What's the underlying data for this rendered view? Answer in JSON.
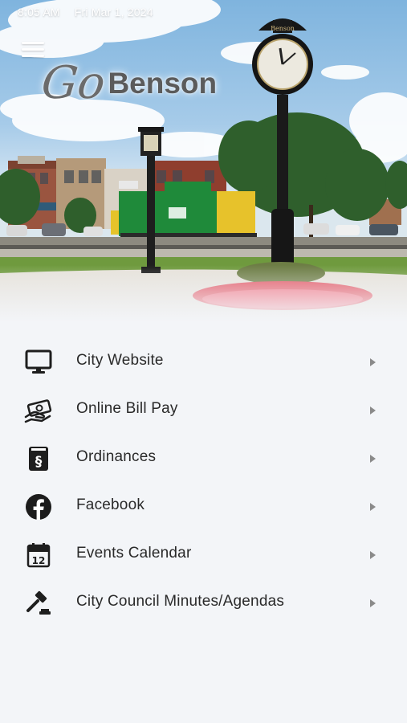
{
  "status_bar": {
    "time": "8:05 AM",
    "date": "Fri Mar 1, 2024"
  },
  "app": {
    "logo_go": "Go",
    "logo_name": "Benson",
    "clock_label": "Benson"
  },
  "colors": {
    "background": "#f3f5f8",
    "text": "#2a2a2a",
    "icon": "#1e1e1e",
    "chevron": "#8a8a8a",
    "facebook": "#1c1c1c"
  },
  "menu": [
    {
      "label": "City Website",
      "icon": "monitor-icon"
    },
    {
      "label": "Online Bill Pay",
      "icon": "bill-pay-icon"
    },
    {
      "label": "Ordinances",
      "icon": "ordinance-book-icon"
    },
    {
      "label": "Facebook",
      "icon": "facebook-icon"
    },
    {
      "label": "Events Calendar",
      "icon": "calendar-icon",
      "icon_text": "12"
    },
    {
      "label": "City Council Minutes/Agendas",
      "icon": "gavel-icon"
    }
  ]
}
